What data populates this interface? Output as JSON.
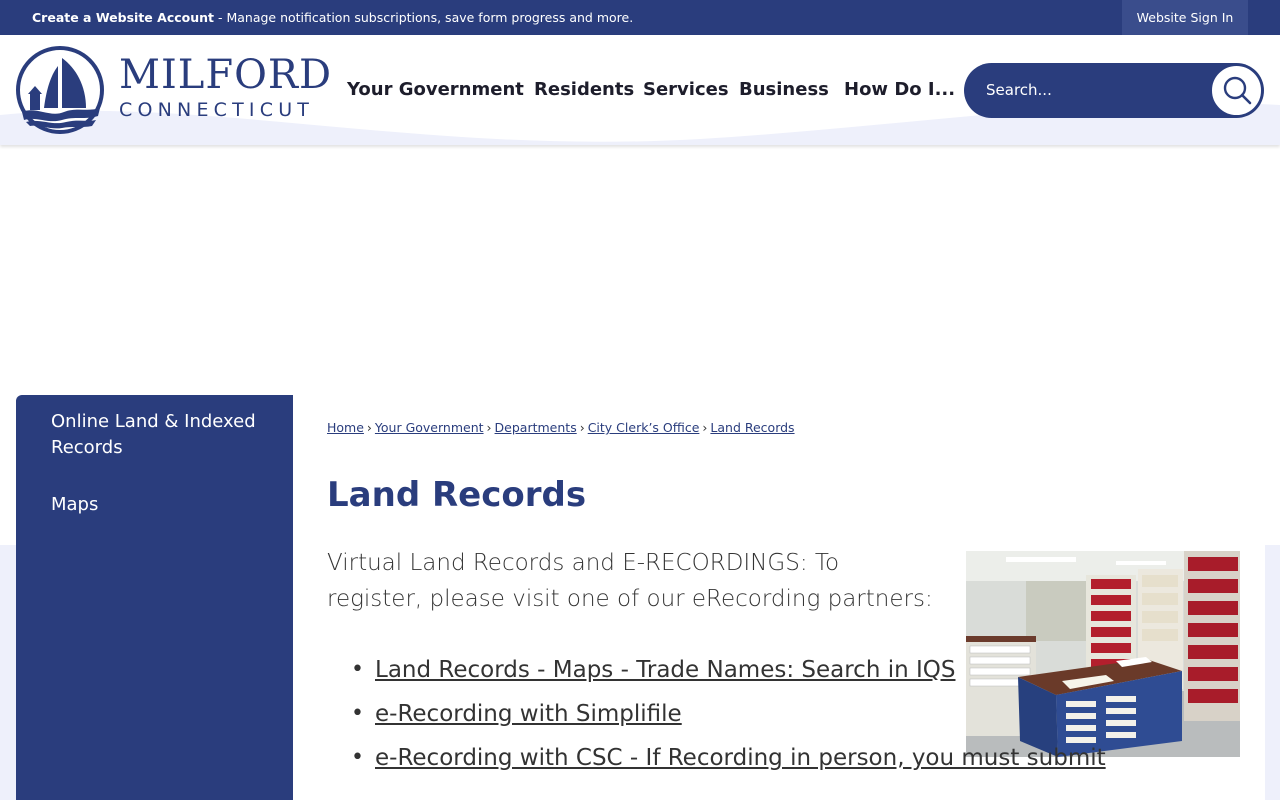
{
  "topbar": {
    "create_link": "Create a Website Account",
    "message": " - Manage notification subscriptions, save form progress and more.",
    "signin": "Website Sign In"
  },
  "logo": {
    "name": "MILFORD",
    "sub": "CONNECTICUT"
  },
  "nav": [
    {
      "label": "Your Government"
    },
    {
      "label": "Residents"
    },
    {
      "label": "Services"
    },
    {
      "label": "Business"
    },
    {
      "label": "How Do I..."
    }
  ],
  "search": {
    "placeholder": "Search...",
    "icon": "search-icon"
  },
  "sidebar": {
    "items": [
      {
        "label": "Online Land & Indexed Records"
      },
      {
        "label": "Maps"
      }
    ]
  },
  "breadcrumb": [
    "Home",
    "Your Government",
    "Departments",
    "City Clerk’s Office",
    "Land Records"
  ],
  "page_title": "Land Records",
  "intro": "Virtual Land Records and E-RECORDINGS: To register, please visit one of our eRecording partners:",
  "links": [
    "Land Records - Maps - Trade Names: Search in IQS",
    "e-Recording with Simplifile",
    "e-Recording with CSC - If Recording in person, you must submit"
  ],
  "colors": {
    "brand": "#2a3d7d",
    "background_band": "#eef0fb",
    "text": "#333333"
  }
}
